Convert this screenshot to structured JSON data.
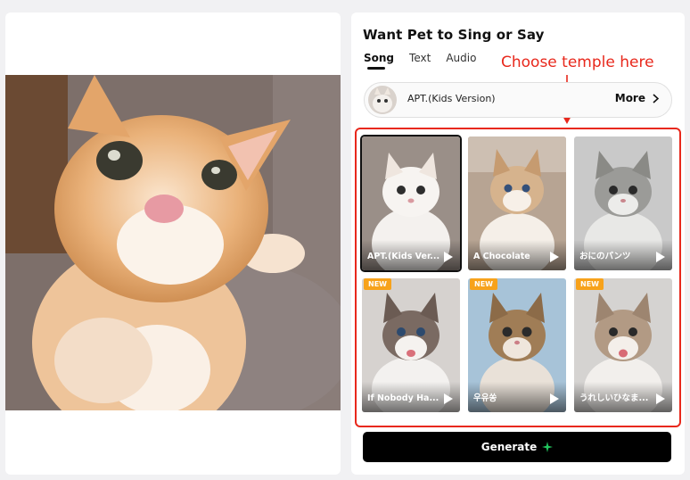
{
  "panel": {
    "title": "Want Pet to Sing or Say",
    "tabs": [
      {
        "label": "Song",
        "active": true
      },
      {
        "label": "Text",
        "active": false
      },
      {
        "label": "Audio",
        "active": false
      }
    ]
  },
  "annotation": {
    "text": "Choose temple here",
    "color": "#e8281c"
  },
  "selected_song": {
    "name": "APT.(Kids Version)",
    "more_label": "More"
  },
  "templates": [
    {
      "label": "APT.(Kids Ver...",
      "new": false,
      "selected": true
    },
    {
      "label": "A Chocolate",
      "new": false,
      "selected": false
    },
    {
      "label": "おにのパンツ",
      "new": false,
      "selected": false
    },
    {
      "label": "If Nobody Ha...",
      "new": true,
      "selected": false
    },
    {
      "label": "우유쏭",
      "new": true,
      "selected": false
    },
    {
      "label": "うれしいひなま...",
      "new": true,
      "selected": false
    }
  ],
  "badge_label": "NEW",
  "generate": {
    "label": "Generate"
  },
  "colors": {
    "accent_red": "#e8281c",
    "badge_orange": "#f7a21b",
    "button_black": "#000000",
    "sparkle_green": "#22c55e"
  }
}
